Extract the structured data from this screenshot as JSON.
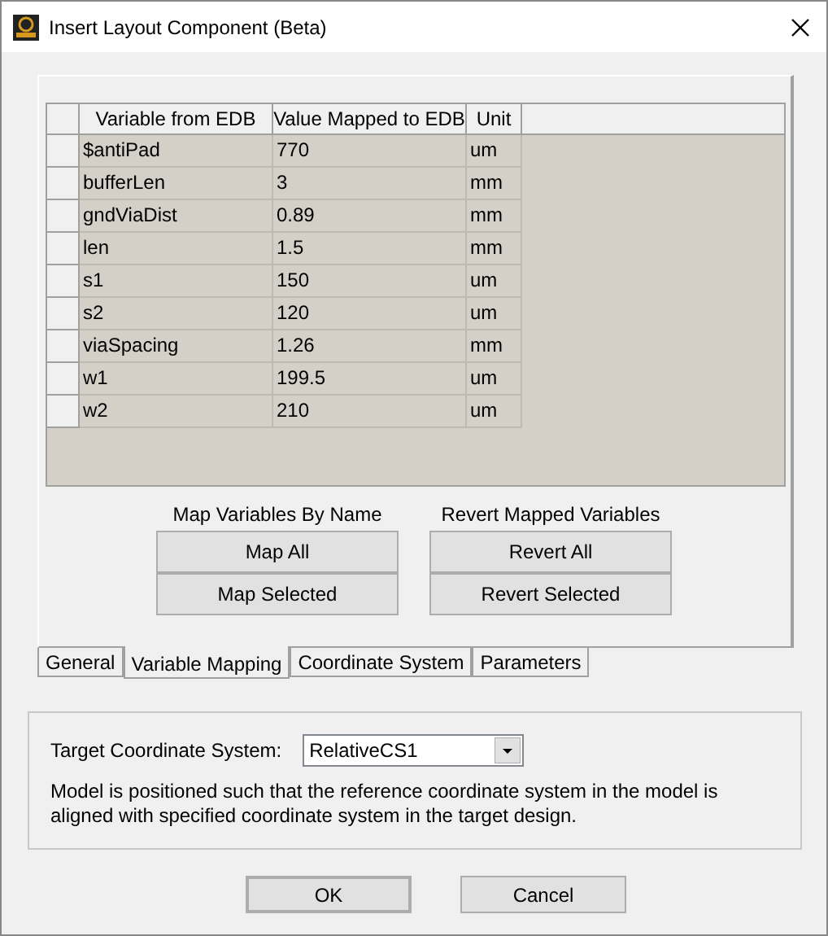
{
  "window": {
    "title": "Insert Layout Component (Beta)"
  },
  "table": {
    "columns": [
      "Variable from EDB",
      "Value Mapped to EDB",
      "Unit"
    ],
    "rows": [
      {
        "variable": "$antiPad",
        "value": "770",
        "unit": "um"
      },
      {
        "variable": "bufferLen",
        "value": "3",
        "unit": "mm"
      },
      {
        "variable": "gndViaDist",
        "value": "0.89",
        "unit": "mm"
      },
      {
        "variable": "len",
        "value": "1.5",
        "unit": "mm"
      },
      {
        "variable": "s1",
        "value": "150",
        "unit": "um"
      },
      {
        "variable": "s2",
        "value": "120",
        "unit": "um"
      },
      {
        "variable": "viaSpacing",
        "value": "1.26",
        "unit": "mm"
      },
      {
        "variable": "w1",
        "value": "199.5",
        "unit": "um"
      },
      {
        "variable": "w2",
        "value": "210",
        "unit": "um"
      }
    ]
  },
  "button_groups": [
    {
      "label": "Map Variables By Name",
      "buttons": [
        "Map All",
        "Map Selected"
      ]
    },
    {
      "label": "Revert Mapped Variables",
      "buttons": [
        "Revert All",
        "Revert Selected"
      ]
    }
  ],
  "tabs": [
    {
      "label": "General",
      "selected": false
    },
    {
      "label": "Variable Mapping",
      "selected": true
    },
    {
      "label": "Coordinate System",
      "selected": false
    },
    {
      "label": "Parameters",
      "selected": false
    }
  ],
  "coordinate": {
    "label": "Target Coordinate System:",
    "value": "RelativeCS1",
    "description": "Model is positioned such that the reference coordinate system in the model is aligned with specified coordinate system in the target design."
  },
  "buttons": [
    "OK",
    "Cancel"
  ]
}
